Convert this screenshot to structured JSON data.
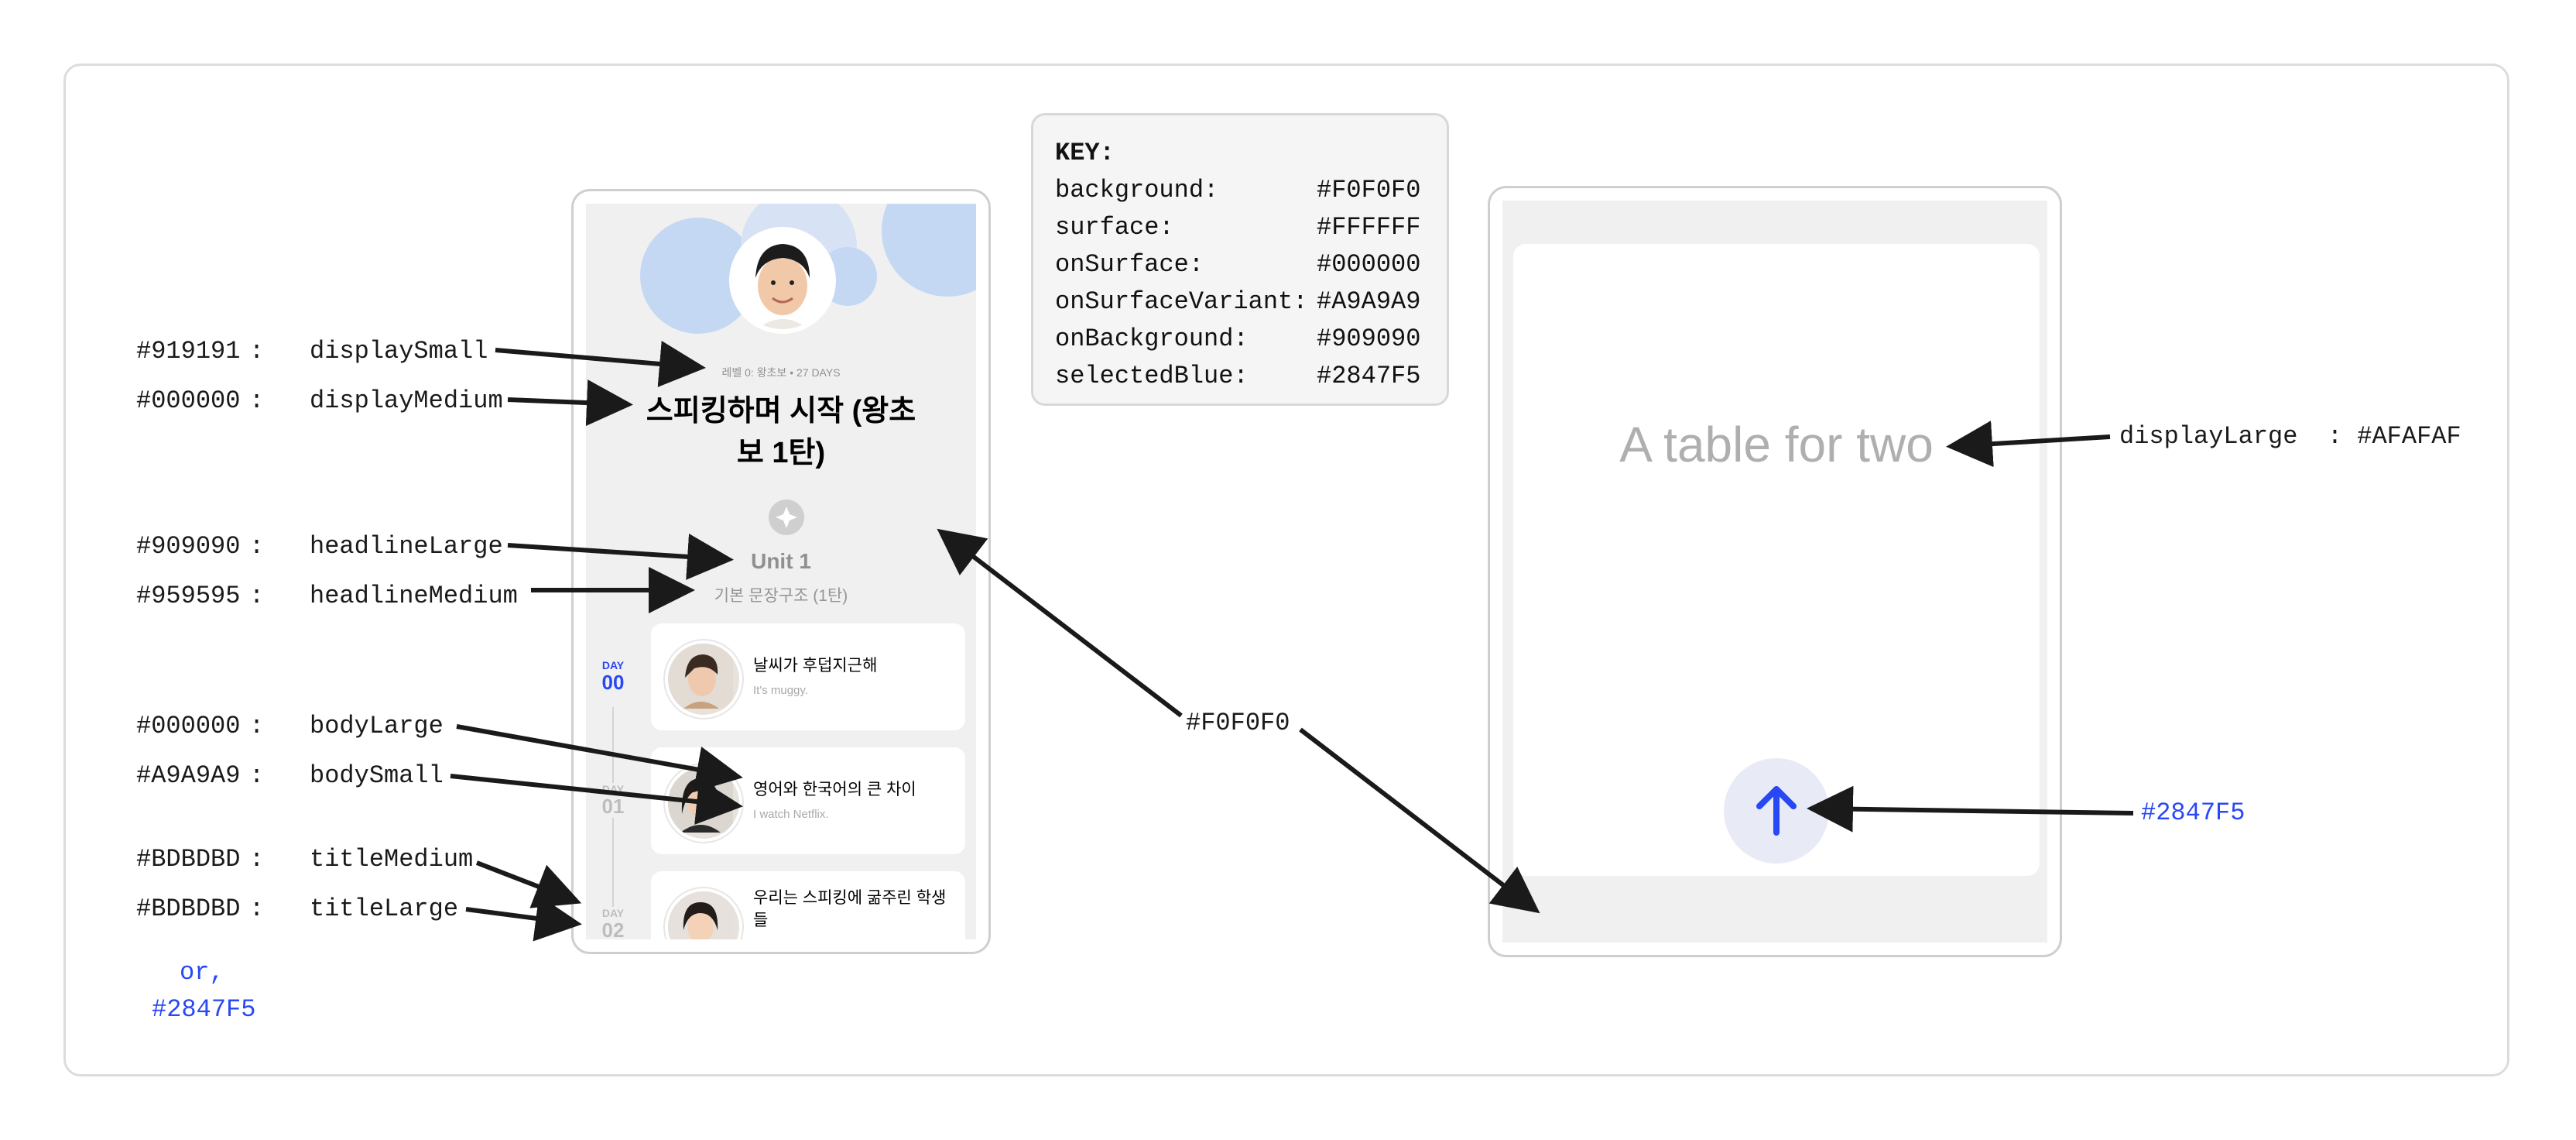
{
  "annotations_left": [
    {
      "hex": "#919191",
      "role": "displaySmall"
    },
    {
      "hex": "#000000",
      "role": "displayMedium"
    },
    {
      "hex": "#909090",
      "role": "headlineLarge"
    },
    {
      "hex": "#959595",
      "role": "headlineMedium"
    },
    {
      "hex": "#000000",
      "role": "bodyLarge"
    },
    {
      "hex": "#A9A9A9",
      "role": "bodySmall"
    },
    {
      "hex": "#BDBDBD",
      "role": "titleMedium"
    },
    {
      "hex": "#BDBDBD",
      "role": "titleLarge"
    }
  ],
  "or_note": {
    "line1": "or,",
    "line2": "#2847F5"
  },
  "colon": ":",
  "phone1": {
    "meta": "레벨 0: 왕초보 • 27 DAYS",
    "title_line1": "스피킹하며 시작 (왕초",
    "title_line2": "보 1탄)",
    "unit_title": "Unit 1",
    "unit_subtitle": "기본 문장구조 (1탄)",
    "days": [
      {
        "label": "DAY",
        "num": "00",
        "active": true,
        "title": "날씨가 후덥지근해",
        "subtitle": "It's muggy."
      },
      {
        "label": "DAY",
        "num": "01",
        "active": false,
        "title": "영어와 한국어의 큰 차이",
        "subtitle": "I watch Netflix."
      },
      {
        "label": "DAY",
        "num": "02",
        "active": false,
        "title": "우리는 스피킹에 굶주린 학생들",
        "subtitle": ""
      }
    ]
  },
  "key": {
    "heading": "KEY:",
    "rows": [
      {
        "name": "background:",
        "value": "#F0F0F0"
      },
      {
        "name": "surface:",
        "value": "#FFFFFF"
      },
      {
        "name": "onSurface:",
        "value": "#000000"
      },
      {
        "name": "onSurfaceVariant:",
        "value": "#A9A9A9"
      },
      {
        "name": "onBackground:",
        "value": "#909090"
      },
      {
        "name": "selectedBlue:",
        "value": "#2847F5"
      }
    ]
  },
  "center_label": "#F0F0F0",
  "phone2": {
    "placeholder": "A table for two",
    "send_icon": "arrow-up-icon"
  },
  "right_labels": {
    "display_large": "displayLarge  : #AFAFAF",
    "send_color": "#2847F5"
  },
  "colors": {
    "accent": "#2847F5",
    "background": "#F0F0F0",
    "surface": "#FFFFFF"
  }
}
